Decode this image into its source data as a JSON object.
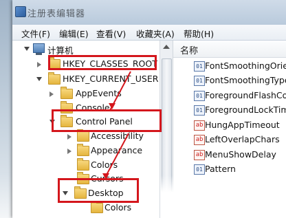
{
  "window": {
    "title": "注册表编辑器"
  },
  "menu": [
    {
      "label": "文件(F)"
    },
    {
      "label": "编辑(E)"
    },
    {
      "label": "查看(V)"
    },
    {
      "label": "收藏夹(A)"
    },
    {
      "label": "帮助(H)"
    }
  ],
  "tree": {
    "root": "计算机",
    "items": [
      {
        "label": "HKEY_CLASSES_ROOT"
      },
      {
        "label": "HKEY_CURRENT_USER"
      },
      {
        "label": "AppEvents"
      },
      {
        "label": "Console"
      },
      {
        "label": "Control Panel"
      },
      {
        "label": "Accessibility"
      },
      {
        "label": "Appearance"
      },
      {
        "label": "Colors"
      },
      {
        "label": "Cursors"
      },
      {
        "label": "Desktop"
      },
      {
        "label": "Colors"
      }
    ]
  },
  "list": {
    "column": "名称",
    "items": [
      {
        "label": "FontSmoothingOrient",
        "icon": "binary-value-icon"
      },
      {
        "label": "FontSmoothingType",
        "icon": "binary-value-icon"
      },
      {
        "label": "ForegroundFlashCou",
        "icon": "binary-value-icon"
      },
      {
        "label": "ForegroundLockTime",
        "icon": "binary-value-icon"
      },
      {
        "label": "HungAppTimeout",
        "icon": "string-value-icon"
      },
      {
        "label": "LeftOverlapChars",
        "icon": "string-value-icon"
      },
      {
        "label": "MenuShowDelay",
        "icon": "string-value-icon"
      },
      {
        "label": "Pattern",
        "icon": "binary-value-icon"
      }
    ]
  },
  "colors": {
    "highlight": "#d4161c"
  }
}
